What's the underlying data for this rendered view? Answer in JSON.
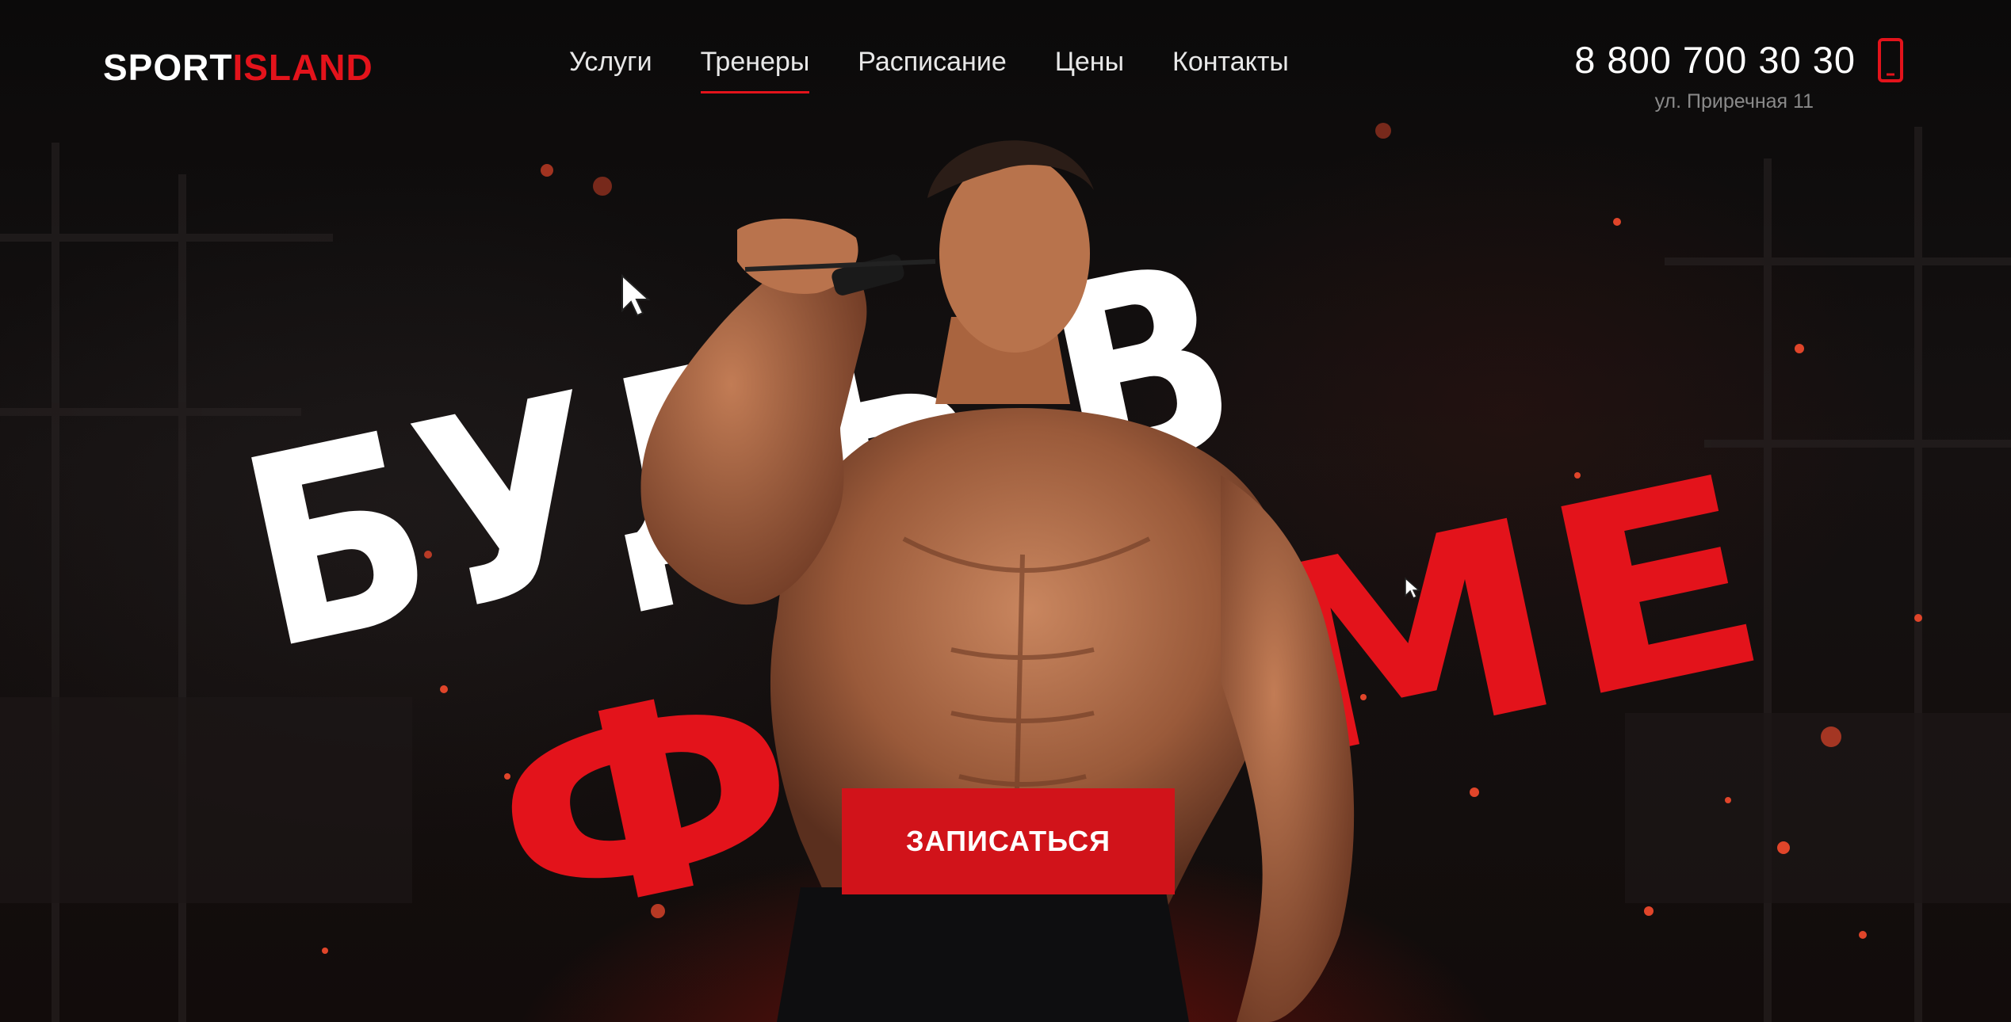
{
  "brand": {
    "logo_white": "SPORT",
    "logo_red": "ISLAND"
  },
  "nav": {
    "items": [
      {
        "label": "Услуги"
      },
      {
        "label": "Тренеры",
        "active": true
      },
      {
        "label": "Расписание"
      },
      {
        "label": "Цены"
      },
      {
        "label": "Контакты"
      }
    ]
  },
  "contact": {
    "phone": "8 800 700 30 30",
    "address": "ул. Приречная 11",
    "phone_icon": "smartphone-icon"
  },
  "hero": {
    "headline_line1": "БУДЬ В",
    "headline_line2": "ФОРМЕ",
    "cta_label": "ЗАПИСАТЬСЯ",
    "figure": "muscular-athlete-image"
  },
  "colors": {
    "accent": "#e3131b",
    "button": "#d1131a",
    "background": "#0d0b0b",
    "text": "#ffffff",
    "muted": "#8a8a8a"
  }
}
